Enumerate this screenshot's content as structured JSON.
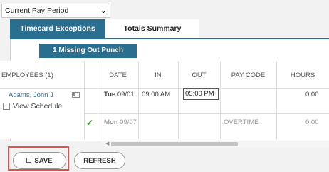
{
  "period_select": {
    "value": "Current Pay Period",
    "icon": "chevron-down-icon"
  },
  "tabs": [
    {
      "label": "Timecard Exceptions",
      "active": true
    },
    {
      "label": "Totals Summary",
      "active": false
    }
  ],
  "exception_button": {
    "label": "1 Missing Out Punch"
  },
  "columns": [
    "EMPLOYEES (1)",
    "DATE",
    "IN",
    "OUT",
    "PAY CODE",
    "HOURS"
  ],
  "employee": {
    "name": "Adams, John J",
    "view_schedule_label": "View Schedule",
    "view_schedule_checked": false
  },
  "rows": [
    {
      "day": "Tue",
      "date": "09/01",
      "in": "09:00 AM",
      "out": "05:00 PM",
      "pay_code": "",
      "hours": "0.00",
      "approved": false
    },
    {
      "day": "Mon",
      "date": "09/07",
      "in": "",
      "out": "",
      "pay_code": "OVERTIME",
      "hours": "0.00",
      "approved": true
    }
  ],
  "buttons": {
    "save": "SAVE",
    "refresh": "REFRESH"
  },
  "colors": {
    "accent": "#2a6f8f",
    "highlight": "#d9534f",
    "approved": "#3a8a2e"
  }
}
